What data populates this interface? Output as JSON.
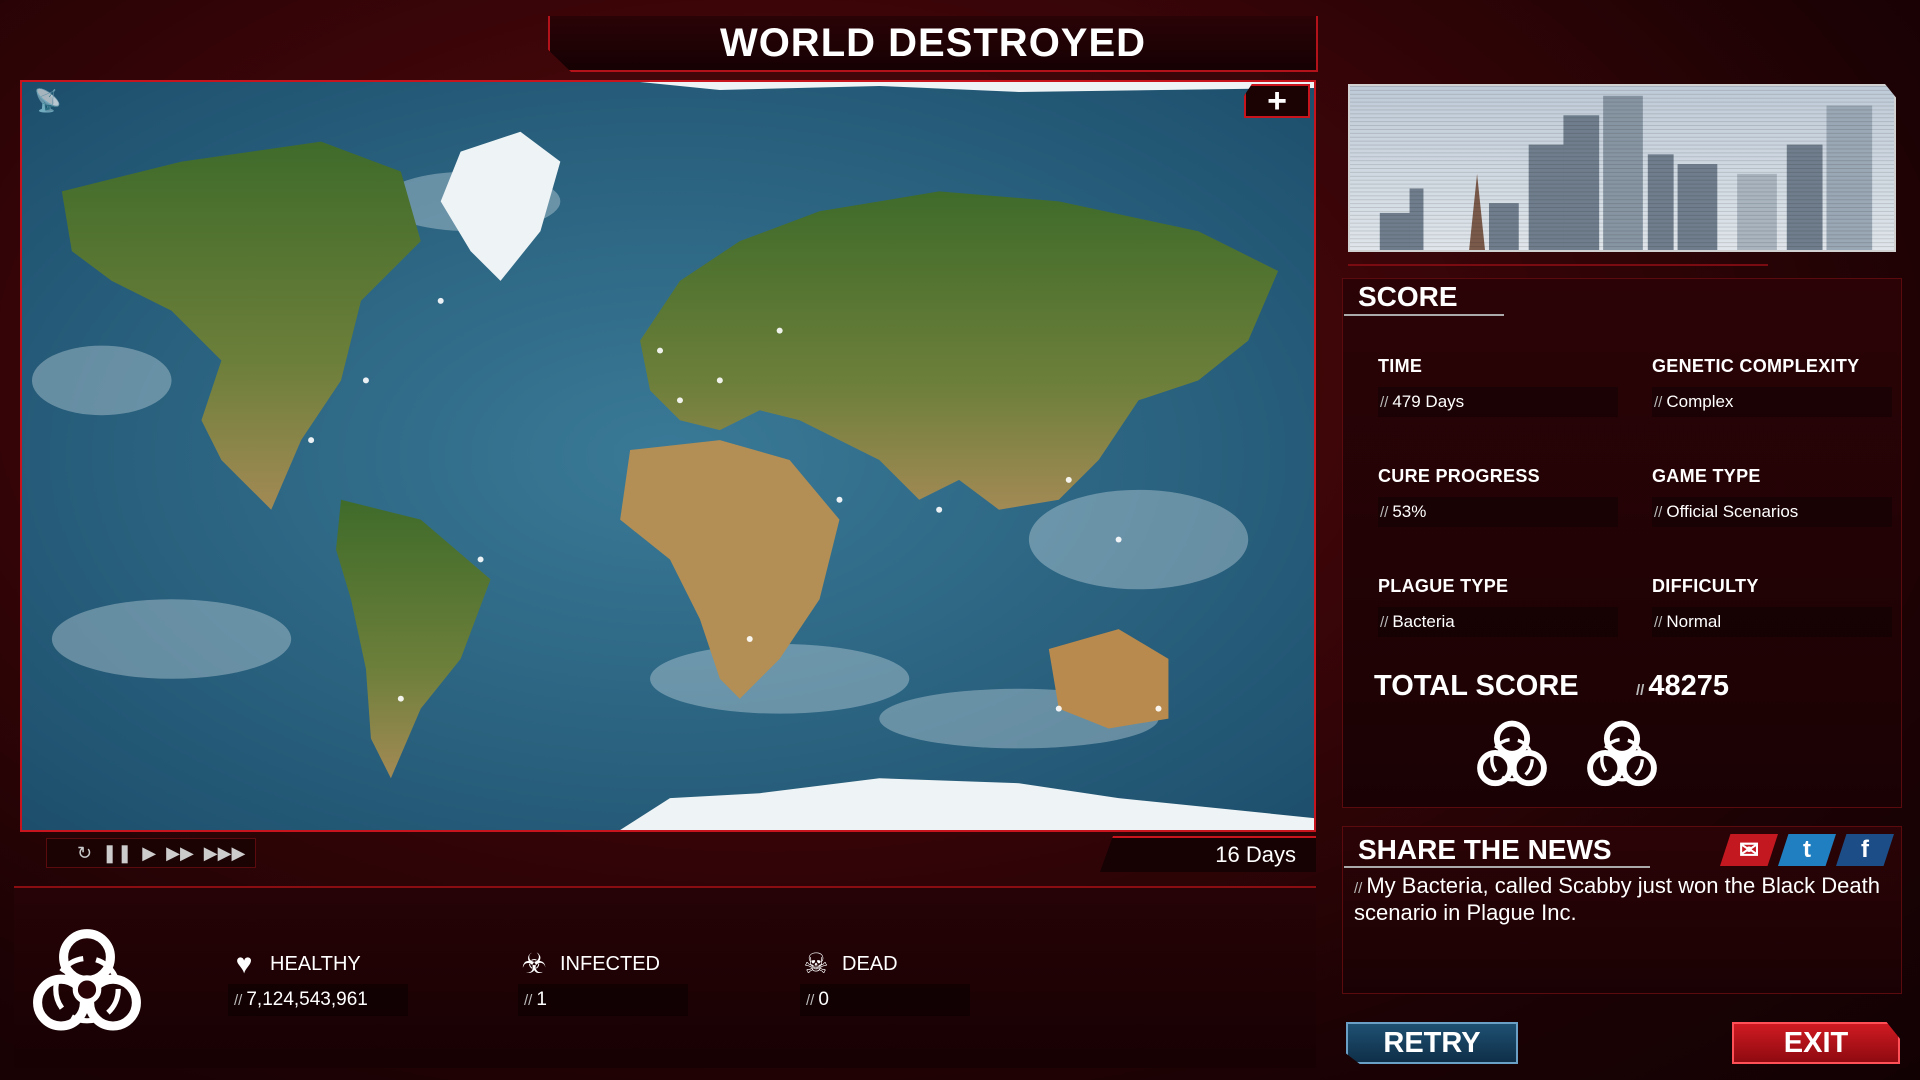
{
  "header": {
    "title": "WORLD DESTROYED"
  },
  "map": {
    "zoom_label": "+",
    "signal_glyph": "📡",
    "days_counter": "16 Days"
  },
  "speed_controls": {
    "restart_glyph": "↻",
    "pause_glyph": "❚❚",
    "play_glyph": "▶",
    "fast_glyph": "▶▶",
    "fastest_glyph": "▶▶▶"
  },
  "stats": {
    "healthy": {
      "label": "HEALTHY",
      "value": "7,124,543,961",
      "icon": "heart-icon"
    },
    "infected": {
      "label": "INFECTED",
      "value": "1",
      "icon": "biohazard-icon"
    },
    "dead": {
      "label": "DEAD",
      "value": "0",
      "icon": "skull-icon"
    },
    "slash": "//"
  },
  "score": {
    "title": "SCORE",
    "items": [
      {
        "label": "TIME",
        "value": "479 Days"
      },
      {
        "label": "GENETIC COMPLEXITY",
        "value": "Complex"
      },
      {
        "label": "CURE PROGRESS",
        "value": "53%"
      },
      {
        "label": "GAME TYPE",
        "value": "Official Scenarios"
      },
      {
        "label": "PLAGUE TYPE",
        "value": "Bacteria"
      },
      {
        "label": "DIFFICULTY",
        "value": "Normal"
      }
    ],
    "slash": "//",
    "total_label": "TOTAL SCORE",
    "total_value": "48275",
    "hazard_icons": 2
  },
  "share": {
    "title": "SHARE THE NEWS",
    "message": "My Bacteria, called Scabby just won the Black Death scenario in Plague Inc.",
    "slash": "//",
    "email_glyph": "✉",
    "twitter_glyph": "t",
    "facebook_glyph": "f"
  },
  "buttons": {
    "retry": "RETRY",
    "exit": "EXIT"
  },
  "colors": {
    "accent_red": "#c8141c",
    "retry_blue": "#1e5072",
    "exit_red": "#d01a22",
    "ocean": "#2c6783",
    "land": "#4f7a2e"
  }
}
